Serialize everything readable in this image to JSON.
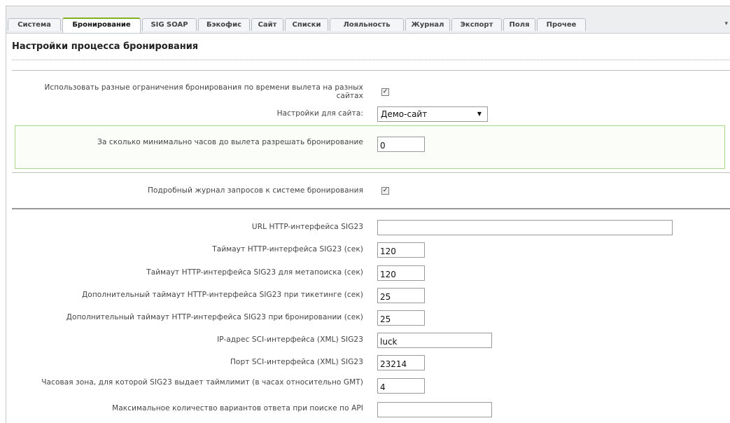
{
  "tabs": [
    {
      "label": "Система"
    },
    {
      "label": "Бронирование"
    },
    {
      "label": "SIG SOAP"
    },
    {
      "label": "Бэкофис"
    },
    {
      "label": "Сайт"
    },
    {
      "label": "Списки"
    },
    {
      "label": "Лояльность"
    },
    {
      "label": "Журнал"
    },
    {
      "label": "Экспорт"
    },
    {
      "label": "Поля"
    },
    {
      "label": "Прочее"
    }
  ],
  "active_tab": "Бронирование",
  "tab_scroll_glyph": "▾",
  "page_title": "Настройки процесса бронирования",
  "settings": {
    "different_limits_label": "Использовать разные ограничения бронирования по времени вылета на разных сайтах",
    "different_limits_checked": true,
    "site_settings_label": "Настройки для сайта:",
    "site_settings_value": "Демо-сайт",
    "min_hours_label": "За сколько минимально часов до вылета разрешать бронирование",
    "min_hours_value": "0",
    "verbose_log_label": "Подробный журнал запросов к системе бронирования",
    "verbose_log_checked": true
  },
  "sig23": {
    "url_label": "URL HTTP-интерфейса SIG23",
    "url_value": "",
    "timeout_label": "Таймаут HTTP-интерфейса SIG23 (сек)",
    "timeout_value": "120",
    "meta_timeout_label": "Таймаут HTTP-интерфейса SIG23 для метапоиска (сек)",
    "meta_timeout_value": "120",
    "ticketing_timeout_label": "Дополнительный таймаут HTTP-интерфейса SIG23 при тикетинге (сек)",
    "ticketing_timeout_value": "25",
    "booking_timeout_label": "Дополнительный таймаут HTTP-интерфейса SIG23 при бронировании (сек)",
    "booking_timeout_value": "25",
    "sci_ip_label": "IP-адрес SCI-интерфейса (XML) SIG23",
    "sci_ip_value": "luck",
    "sci_port_label": "Порт SCI-интерфейса (XML) SIG23",
    "sci_port_value": "23214",
    "timezone_label": "Часовая зона, для которой SIG23 выдает таймлимит (в часах относительно GMT)",
    "timezone_value": "4",
    "max_variants_label": "Максимальное количество вариантов ответа при поиске по API",
    "max_variants_value": ""
  },
  "colors": {
    "active_tab_accent": "#7fb21e",
    "green_box_border": "#a9d88b"
  }
}
